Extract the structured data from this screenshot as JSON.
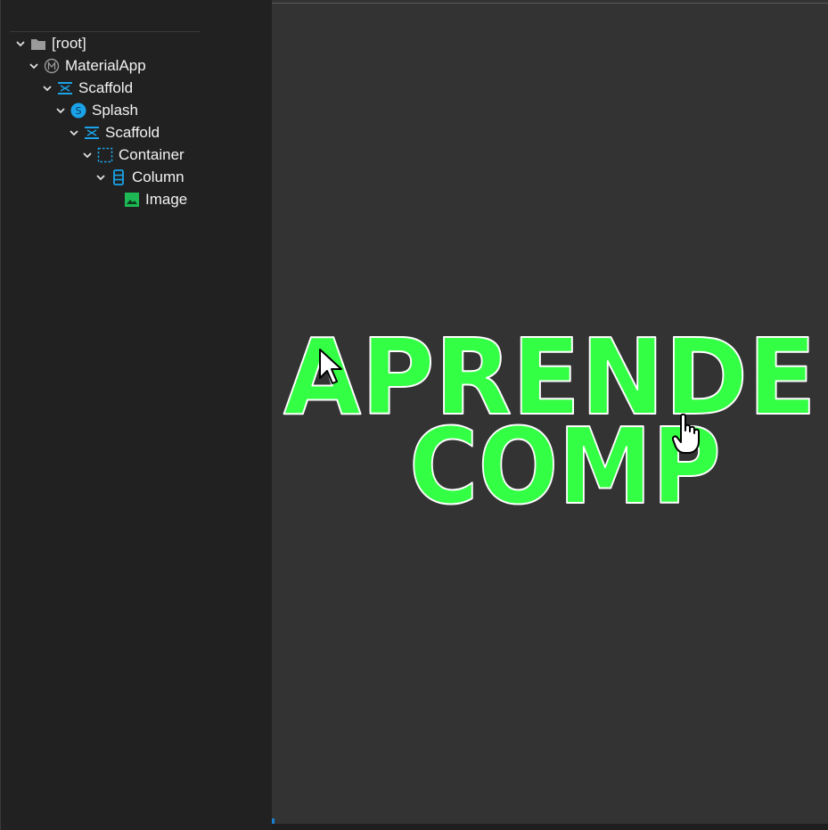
{
  "tree": {
    "items": [
      {
        "label": "[root]",
        "icon": "folder-icon",
        "expanded": true
      },
      {
        "label": "MaterialApp",
        "icon": "material-app-icon",
        "expanded": true
      },
      {
        "label": "Scaffold",
        "icon": "scaffold-icon",
        "expanded": true
      },
      {
        "label": "Splash",
        "icon": "splash-icon",
        "expanded": true
      },
      {
        "label": "Scaffold",
        "icon": "scaffold-icon",
        "expanded": true
      },
      {
        "label": "Container",
        "icon": "container-icon",
        "expanded": true
      },
      {
        "label": "Column",
        "icon": "column-icon",
        "expanded": true
      },
      {
        "label": "Image",
        "icon": "image-icon",
        "expanded": false
      }
    ]
  },
  "preview": {
    "logo_line1": "APRENDE",
    "logo_line2": "COMP",
    "logo_color": "#33ff44",
    "background": "#333333"
  },
  "colors": {
    "accent_blue": "#1aa3e8",
    "image_green": "#1db954",
    "folder_gray": "#9a9a9a"
  }
}
